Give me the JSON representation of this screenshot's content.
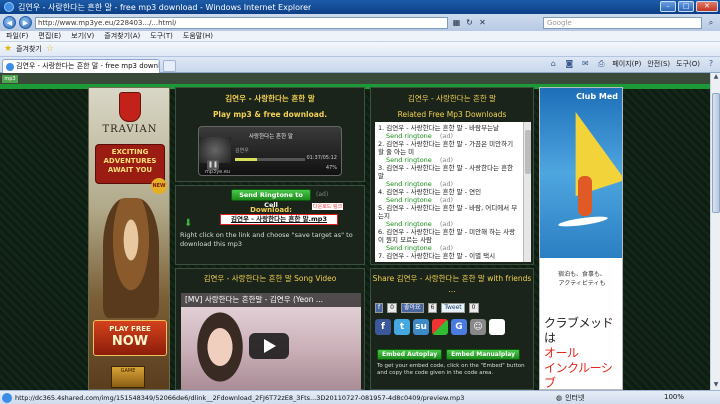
{
  "window": {
    "title": "김연우 - 사랑한다는 흔한 말 - free mp3 download - Windows Internet Explorer",
    "controls": {
      "minimize": "–",
      "maximize": "□",
      "close": "✕"
    }
  },
  "address": {
    "url": "http://www.mp3ye.eu/228403.../...html/",
    "search_placeholder": "Google"
  },
  "menu": {
    "items": [
      "파일(F)",
      "편집(E)",
      "보기(V)",
      "즐겨찾기(A)",
      "도구(T)",
      "도움말(H)"
    ]
  },
  "favorites": {
    "label": "즐겨찾기"
  },
  "tab": {
    "title": "김연우 - 사랑한다는 흔한 말 - free mp3 downl..."
  },
  "commandbar": {
    "page": "페이지(P)",
    "safety": "안전(S)",
    "tools": "도구(O)"
  },
  "page": {
    "player_panel": {
      "title": "김연우 - 사랑한다는 흔한 말",
      "subtitle": "Play mp3 & free download.",
      "player_track": "사랑한다는 흔한 말",
      "player_artist": "김연우",
      "player_time": "01:37/05:12",
      "player_volume": "47%",
      "player_brand": "mp3ye.eu",
      "progress_fraction": 0.31
    },
    "ringtone_panel": {
      "send_button": "Send Ringtone to Cell",
      "ad_tag": "(ad)",
      "download_label": "Download:",
      "hint": "다운로드 링크",
      "file_link": "김연우 - 사랑한다는 흔한 말.mp3",
      "note": "Right click on the link and choose \"save target as\" to download this mp3"
    },
    "related_panel": {
      "title": "김연우 - 사랑한다는 흔한 말",
      "subtitle": "Related Free Mp3 Downloads",
      "ringtone_label": "Send ringtone",
      "ad_tag": "(ad)",
      "items": [
        "1. 김연우 - 사랑한다는 흔한 말 - 바람부는날",
        "2. 김연우 - 사랑한다는 흔한 말 - 가끔은 미안하기 할 줄 아는 미",
        "3. 김연우 - 사랑한다는 흔한 말 - 사랑한다는 흔한 말",
        "4. 김연우 - 사랑한다는 흔한 말 - 연인",
        "5. 김연우 - 사랑한다는 흔한 말 - 바람, 어디에서 부는지",
        "6. 김연우 - 사랑한다는 흔한 말 - 미안해 하는 사랑이 뭔지 모르는 사람",
        "7. 김연우 - 사랑한다는 흔한 말 - 이별 택시"
      ]
    },
    "video_panel": {
      "title": "김연우 - 사랑한다는 흔한 말 Song Video",
      "video_title": "[MV] 사랑한다는 흔한말 - 김연우 (Yeon ..."
    },
    "share_panel": {
      "title": "Share 김연우 - 사랑한다는 흔한 말 with friends ...",
      "fb_label": "f",
      "fb_count": "0",
      "like_label": "좋아요",
      "like_count": "6",
      "tweet_label": "Tweet",
      "tweet_count": "0",
      "embed_auto": "Embed Autoplay",
      "embed_manual": "Embed Manualplay",
      "embed_note": "To get your embed code, click on the \"Embed\" button and copy the code given in the code area."
    },
    "ad_left": {
      "logo": "TRAVIAN",
      "headline": "EXCITING ADVENTURES AWAIT YOU",
      "badge": "NEW",
      "cta_top": "PLAY FREE",
      "cta_bottom": "NOW",
      "box": "GAME"
    },
    "ad_right": {
      "brand": "Club Med",
      "line1": "宿泊も、食事も、",
      "line2": "アクティビティも",
      "big1": "クラブメッドは",
      "big2": "オール",
      "big3": "インクルーシブ"
    }
  },
  "status": {
    "url": "http://dc365.4shared.com/img/151548349/52066de6/dlink__2Fdownload_2FJ6T72zE8_3Fts...3D20110727-081957-4d8c0409/preview.mp3",
    "zone": "인터넷",
    "zoom": "100%"
  }
}
